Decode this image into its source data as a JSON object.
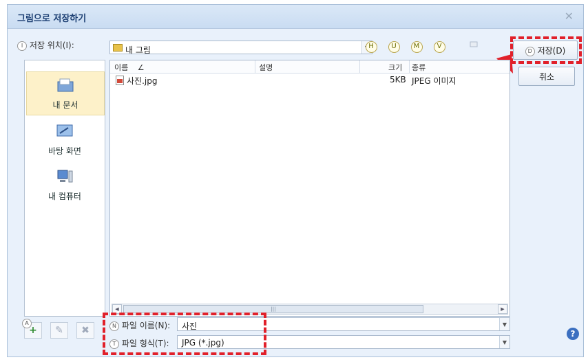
{
  "window": {
    "title": "그림으로 저장하기",
    "close_glyph": "✕"
  },
  "location": {
    "badge": "I",
    "label": "저장 위치(I):",
    "value": "내 그림"
  },
  "toolbar": [
    "H",
    "U",
    "M",
    "V"
  ],
  "buttons": {
    "save_badge": "D",
    "save": "저장(D)",
    "cancel": "취소"
  },
  "places": [
    {
      "label": "내 문서"
    },
    {
      "label": "바탕 화면"
    },
    {
      "label": "내 컴퓨터"
    }
  ],
  "columns": {
    "name": "이름",
    "sort": "∠",
    "desc": "설명",
    "size": "크기",
    "type": "종류"
  },
  "files": [
    {
      "name": "사진.jpg",
      "size": "5KB",
      "type": "JPEG 이미지"
    }
  ],
  "filename": {
    "badge": "N",
    "label": "파일 이름(N):",
    "value": "사진"
  },
  "filetype": {
    "badge": "T",
    "label": "파일 형식(T):",
    "value": "JPG (*.jpg)"
  },
  "bottom_tools": {
    "add_badge": "A"
  },
  "colors": {
    "highlight": "#e1202a",
    "dialog_bg": "#e9f1fb"
  }
}
